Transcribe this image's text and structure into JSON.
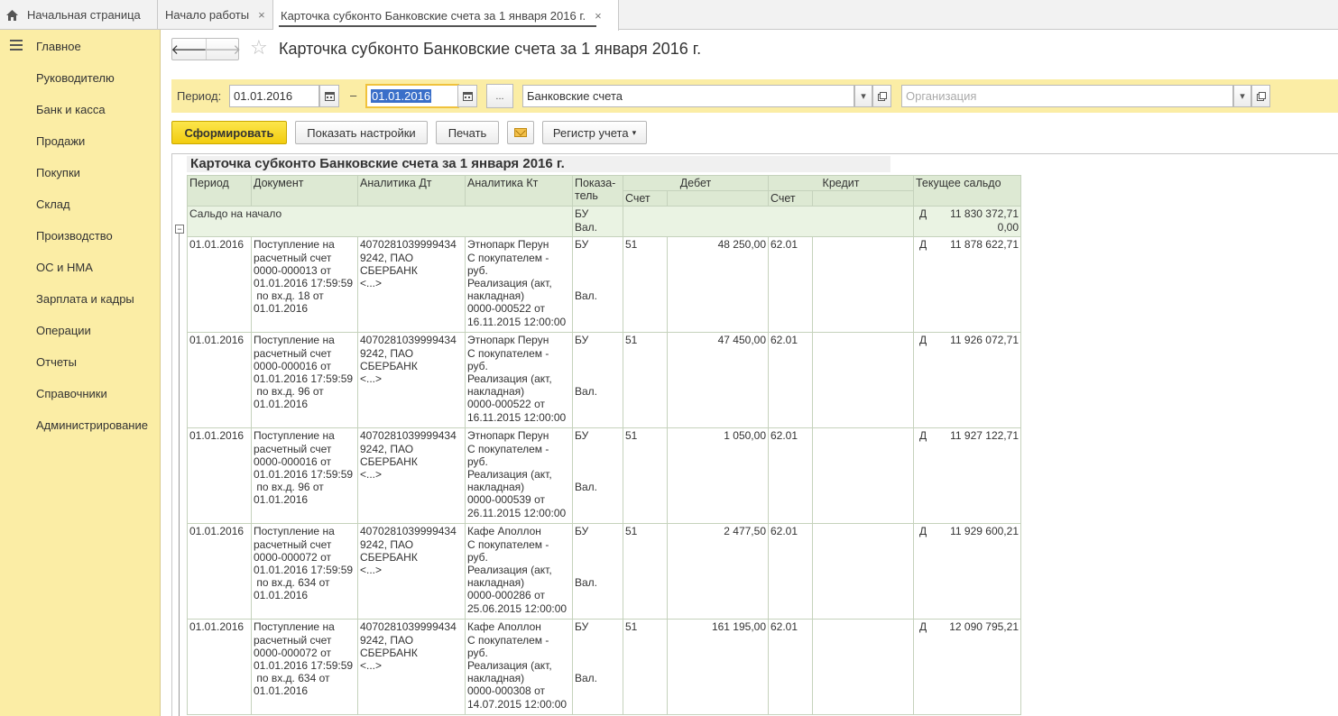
{
  "tabs": [
    {
      "label": "Начальная страница",
      "icon": "home-icon"
    },
    {
      "label": "Начало работы",
      "close": "×"
    },
    {
      "label": "Карточка субконто Банковские счета за 1 января 2016 г.",
      "close": "×"
    }
  ],
  "sidebar": {
    "items": [
      "Главное",
      "Руководителю",
      "Банк и касса",
      "Продажи",
      "Покупки",
      "Склад",
      "Производство",
      "ОС и НМА",
      "Зарплата и кадры",
      "Операции",
      "Отчеты",
      "Справочники",
      "Администрирование"
    ]
  },
  "header": {
    "back": "🡐",
    "forward": "🡒",
    "star": "☆",
    "title": "Карточка субконто Банковские счета за 1 января 2016 г."
  },
  "filters": {
    "period_label": "Период:",
    "date_from": "01.01.2016",
    "dash": "–",
    "date_to": "01.01.2016",
    "dots": "...",
    "subconto": "Банковские счета",
    "organization_placeholder": "Организация"
  },
  "commands": {
    "generate": "Сформировать",
    "show_settings": "Показать настройки",
    "print": "Печать",
    "register": "Регистр учета"
  },
  "report": {
    "title": "Карточка субконто Банковские счета за 1 января 2016 г.",
    "headers": {
      "period": "Период",
      "document": "Документ",
      "analytics_dt": "Аналитика Дт",
      "analytics_kt": "Аналитика Кт",
      "indicator": "Показа-\nтель",
      "debit": "Дебет",
      "credit": "Кредит",
      "account": "Счет",
      "balance": "Текущее сальдо"
    },
    "opening": {
      "label": "Сальдо на начало",
      "ind1": "БУ",
      "ind2": "Вал.",
      "dk": "Д",
      "amount": "11 830 372,71",
      "val": "0,00"
    },
    "rows": [
      {
        "period": "01.01.2016",
        "doc": [
          "Поступление на",
          "расчетный счет",
          "0000-000013 от",
          "01.01.2016 17:59:59",
          " по вх.д. 18 от",
          "01.01.2016"
        ],
        "dt": [
          "4070281039999434",
          "9242, ПАО",
          "СБЕРБАНК",
          "<...>"
        ],
        "kt": [
          "Этнопарк Перун",
          "С покупателем -",
          "руб.",
          "Реализация (акт,",
          "накладная)",
          "0000-000522 от",
          "16.11.2015 12:00:00"
        ],
        "ind1": "БУ",
        "ind2": "Вал.",
        "dacc": "51",
        "damt": "48 250,00",
        "cacc": "62.01",
        "dk": "Д",
        "bal": "11 878 622,71"
      },
      {
        "period": "01.01.2016",
        "doc": [
          "Поступление на",
          "расчетный счет",
          "0000-000016 от",
          "01.01.2016 17:59:59",
          " по вх.д. 96 от",
          "01.01.2016"
        ],
        "dt": [
          "4070281039999434",
          "9242, ПАО",
          "СБЕРБАНК",
          "<...>"
        ],
        "kt": [
          "Этнопарк Перун",
          "С покупателем -",
          "руб.",
          "Реализация (акт,",
          "накладная)",
          "0000-000522 от",
          "16.11.2015 12:00:00"
        ],
        "ind1": "БУ",
        "ind2": "Вал.",
        "dacc": "51",
        "damt": "47 450,00",
        "cacc": "62.01",
        "dk": "Д",
        "bal": "11 926 072,71"
      },
      {
        "period": "01.01.2016",
        "doc": [
          "Поступление на",
          "расчетный счет",
          "0000-000016 от",
          "01.01.2016 17:59:59",
          " по вх.д. 96 от",
          "01.01.2016"
        ],
        "dt": [
          "4070281039999434",
          "9242, ПАО",
          "СБЕРБАНК",
          "<...>"
        ],
        "kt": [
          "Этнопарк Перун",
          "С покупателем -",
          "руб.",
          "Реализация (акт,",
          "накладная)",
          "0000-000539 от",
          "26.11.2015 12:00:00"
        ],
        "ind1": "БУ",
        "ind2": "Вал.",
        "dacc": "51",
        "damt": "1 050,00",
        "cacc": "62.01",
        "dk": "Д",
        "bal": "11 927 122,71"
      },
      {
        "period": "01.01.2016",
        "doc": [
          "Поступление на",
          "расчетный счет",
          "0000-000072 от",
          "01.01.2016 17:59:59",
          " по вх.д. 634 от",
          "01.01.2016"
        ],
        "dt": [
          "4070281039999434",
          "9242, ПАО",
          "СБЕРБАНК",
          "<...>"
        ],
        "kt": [
          "Кафе Аполлон",
          "С покупателем -",
          "руб.",
          "Реализация (акт,",
          "накладная)",
          "0000-000286 от",
          "25.06.2015 12:00:00"
        ],
        "ind1": "БУ",
        "ind2": "Вал.",
        "dacc": "51",
        "damt": "2 477,50",
        "cacc": "62.01",
        "dk": "Д",
        "bal": "11 929 600,21"
      },
      {
        "period": "01.01.2016",
        "doc": [
          "Поступление на",
          "расчетный счет",
          "0000-000072 от",
          "01.01.2016 17:59:59",
          " по вх.д. 634 от",
          "01.01.2016"
        ],
        "dt": [
          "4070281039999434",
          "9242, ПАО",
          "СБЕРБАНК",
          "<...>"
        ],
        "kt": [
          "Кафе Аполлон",
          "С покупателем -",
          "руб.",
          "Реализация (акт,",
          "накладная)",
          "0000-000308 от",
          "14.07.2015 12:00:00"
        ],
        "ind1": "БУ",
        "ind2": "Вал.",
        "dacc": "51",
        "damt": "161 195,00",
        "cacc": "62.01",
        "dk": "Д",
        "bal": "12 090 795,21"
      }
    ]
  }
}
